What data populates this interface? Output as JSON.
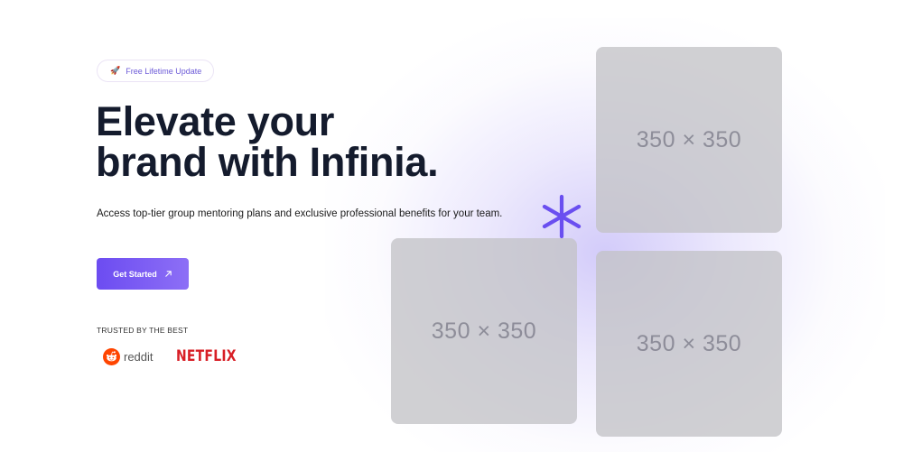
{
  "badge": {
    "icon": "rocket-icon",
    "text": "Free Lifetime Update"
  },
  "hero": {
    "title_line1": "Elevate your",
    "title_line2": "brand with Infinia.",
    "description": "Access top-tier group mentoring plans and exclusive professional benefits for your team."
  },
  "cta": {
    "label": "Get Started",
    "icon": "arrow-up-right-icon"
  },
  "trusted": {
    "heading": "TRUSTED BY THE BEST",
    "logos": [
      {
        "name": "reddit",
        "text": "reddit",
        "color": "#ff4500"
      },
      {
        "name": "netflix",
        "text": "NETFLIX",
        "color": "#d81f26"
      }
    ]
  },
  "placeholders": [
    {
      "text": "350 × 350"
    },
    {
      "text": "350 × 350"
    },
    {
      "text": "350 × 350"
    }
  ],
  "decor": {
    "icon": "asterisk-sparkle-icon",
    "color": "#6a4ff0"
  },
  "colors": {
    "accent": "#6c4cf1",
    "title": "#141b2d"
  }
}
